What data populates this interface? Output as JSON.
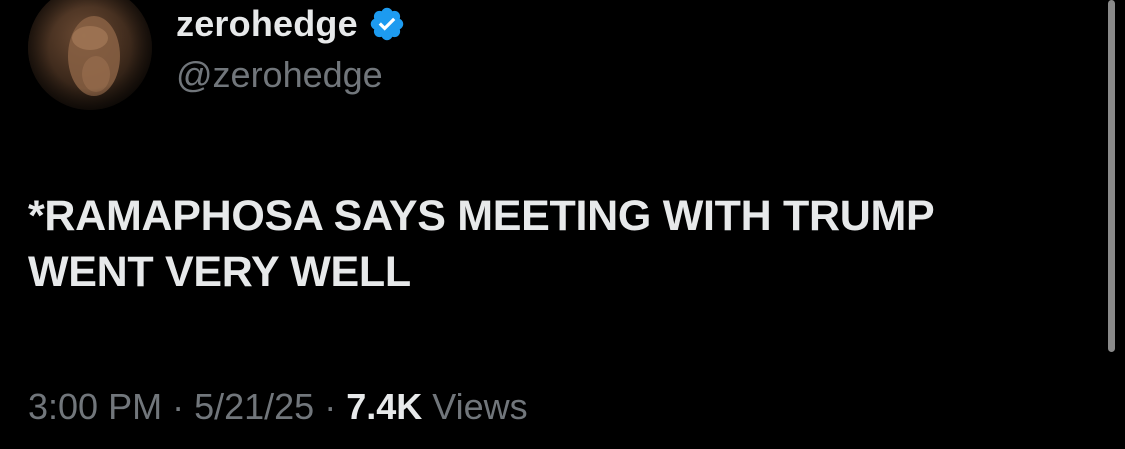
{
  "author": {
    "display_name": "zerohedge",
    "handle": "@zerohedge",
    "verified": true,
    "avatar_icon": "profile-avatar"
  },
  "tweet": {
    "lines": [
      "*RAMAPHOSA SAYS MEETING WITH TRUMP",
      "WENT VERY WELL"
    ]
  },
  "meta": {
    "time": "3:00 PM",
    "separator": "·",
    "date": "5/21/25",
    "views_count": "7.4K",
    "views_label": "Views"
  },
  "colors": {
    "background": "#000000",
    "primary_text": "#e7e9ea",
    "secondary_text": "#71767b",
    "verified_blue": "#1d9bf0"
  }
}
